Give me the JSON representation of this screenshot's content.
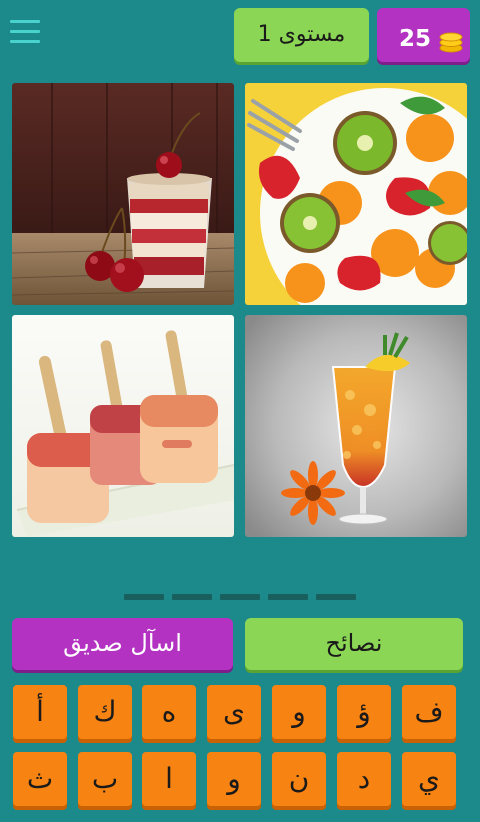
{
  "header": {
    "level_label": "مستوى 1",
    "coins": "25",
    "icons": {
      "menu": "hamburger-menu-icon",
      "coins": "coin-stack-icon"
    }
  },
  "tiles": [
    {
      "image": "cherry-parfait-photo"
    },
    {
      "image": "fruit-salad-photo"
    },
    {
      "image": "fruit-popsicles-photo"
    },
    {
      "image": "orange-cocktail-photo"
    }
  ],
  "answer": {
    "slot_count": 5
  },
  "actions": {
    "ask_friend_label": "اسآل صديق",
    "tips_label": "نصائح"
  },
  "keyboard": {
    "row1": [
      "أ",
      "ك",
      "ه",
      "ى",
      "و",
      "ؤ",
      "ف"
    ],
    "row2": [
      "ث",
      "ب",
      "ا",
      "و",
      "ن",
      "د",
      "ي"
    ]
  },
  "colors": {
    "background": "#1c8a8a",
    "green": "#8bd655",
    "purple": "#b332c2",
    "orange_key": "#f78312",
    "menu_icon": "#48d3cf"
  }
}
